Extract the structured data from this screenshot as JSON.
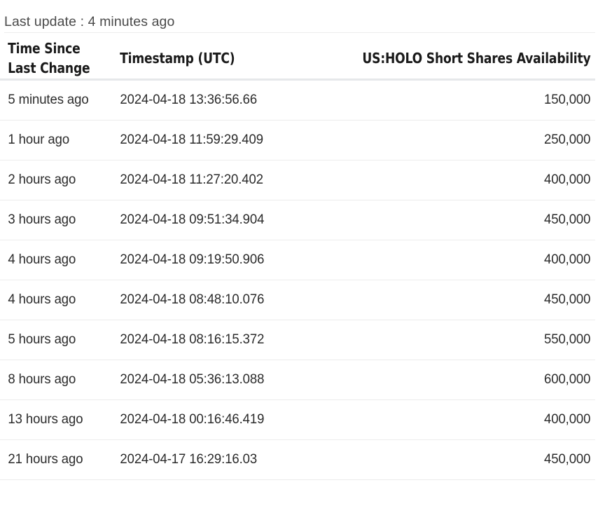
{
  "last_update": {
    "label": "Last update",
    "separator": ":",
    "value": "4 minutes ago"
  },
  "table": {
    "columns": [
      {
        "key": "time_since_last_change",
        "header": "Time Since\nLast Change",
        "align": "left"
      },
      {
        "key": "timestamp_utc",
        "header": "Timestamp (UTC)",
        "align": "left"
      },
      {
        "key": "short_shares_availability",
        "header": "US:HOLO Short Shares Availability",
        "align": "right"
      }
    ],
    "rows": [
      {
        "time_since": "5 minutes ago",
        "timestamp": "2024-04-18 13:36:56.66",
        "availability": "150,000"
      },
      {
        "time_since": "1 hour ago",
        "timestamp": "2024-04-18 11:59:29.409",
        "availability": "250,000"
      },
      {
        "time_since": "2 hours ago",
        "timestamp": "2024-04-18 11:27:20.402",
        "availability": "400,000"
      },
      {
        "time_since": "3 hours ago",
        "timestamp": "2024-04-18 09:51:34.904",
        "availability": "450,000"
      },
      {
        "time_since": "4 hours ago",
        "timestamp": "2024-04-18 09:19:50.906",
        "availability": "400,000"
      },
      {
        "time_since": "4 hours ago",
        "timestamp": "2024-04-18 08:48:10.076",
        "availability": "450,000"
      },
      {
        "time_since": "5 hours ago",
        "timestamp": "2024-04-18 08:16:15.372",
        "availability": "550,000"
      },
      {
        "time_since": "8 hours ago",
        "timestamp": "2024-04-18 05:36:13.088",
        "availability": "600,000"
      },
      {
        "time_since": "13 hours ago",
        "timestamp": "2024-04-18 00:16:46.419",
        "availability": "400,000"
      },
      {
        "time_since": "21 hours ago",
        "timestamp": "2024-04-17 16:29:16.03",
        "availability": "450,000"
      }
    ]
  },
  "colors": {
    "background": "#ffffff",
    "header_text": "#1a1a1a",
    "body_text": "#2b2b2b",
    "muted_text": "#4a4a4a",
    "rule": "#ececec",
    "header_rule": "#e6e8ea"
  }
}
